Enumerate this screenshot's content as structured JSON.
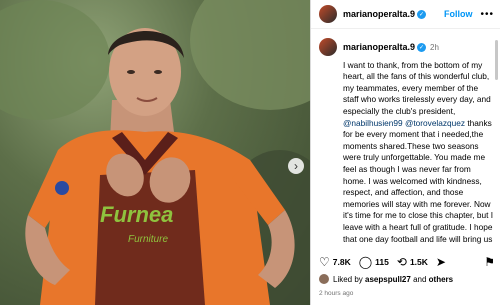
{
  "post": {
    "username": "marianoperalta.9",
    "follow_label": "Follow",
    "more_label": "•••",
    "time": "2h",
    "caption_parts": [
      "I want to thank, from the bottom of my heart, all the fans of this wonderful club, my teammates, every member of the staff who works tirelessly every day, and especially the club's president,",
      "@nabilhusien99",
      "@torovelazquez",
      "thanks for be every moment that i needed,the moments shared.These two seasons were truly unforgettable. You made me feel as though I was never far from home. I was welcomed with kindness, respect, and affection, and those memories will stay with me forever.",
      "Now it's time for me to close this chapter, but I leave with a heart full of gratitude. I hope that one day football and life will bring us together again. Until then, please know that you will"
    ],
    "media_text": {
      "sponsor": "Furnea",
      "sub": "Furniture"
    },
    "colors": {
      "jersey": "#e8762b",
      "jersey_dark": "#5a1f1a",
      "link": "#0095f6",
      "verified": "#1d9bf0"
    }
  },
  "actions": {
    "like_icon": "heart-icon",
    "like_count": "7.8K",
    "comment_icon": "comment-icon",
    "comment_count": "115",
    "repost_icon": "repost-icon",
    "repost_count": "1.5K",
    "share_icon": "send-icon",
    "save_icon": "bookmark-icon"
  },
  "likes": {
    "prefix": "Liked by",
    "user": "asepspull27",
    "and": "and",
    "others": "others"
  },
  "posted_ago": "2 hours ago"
}
